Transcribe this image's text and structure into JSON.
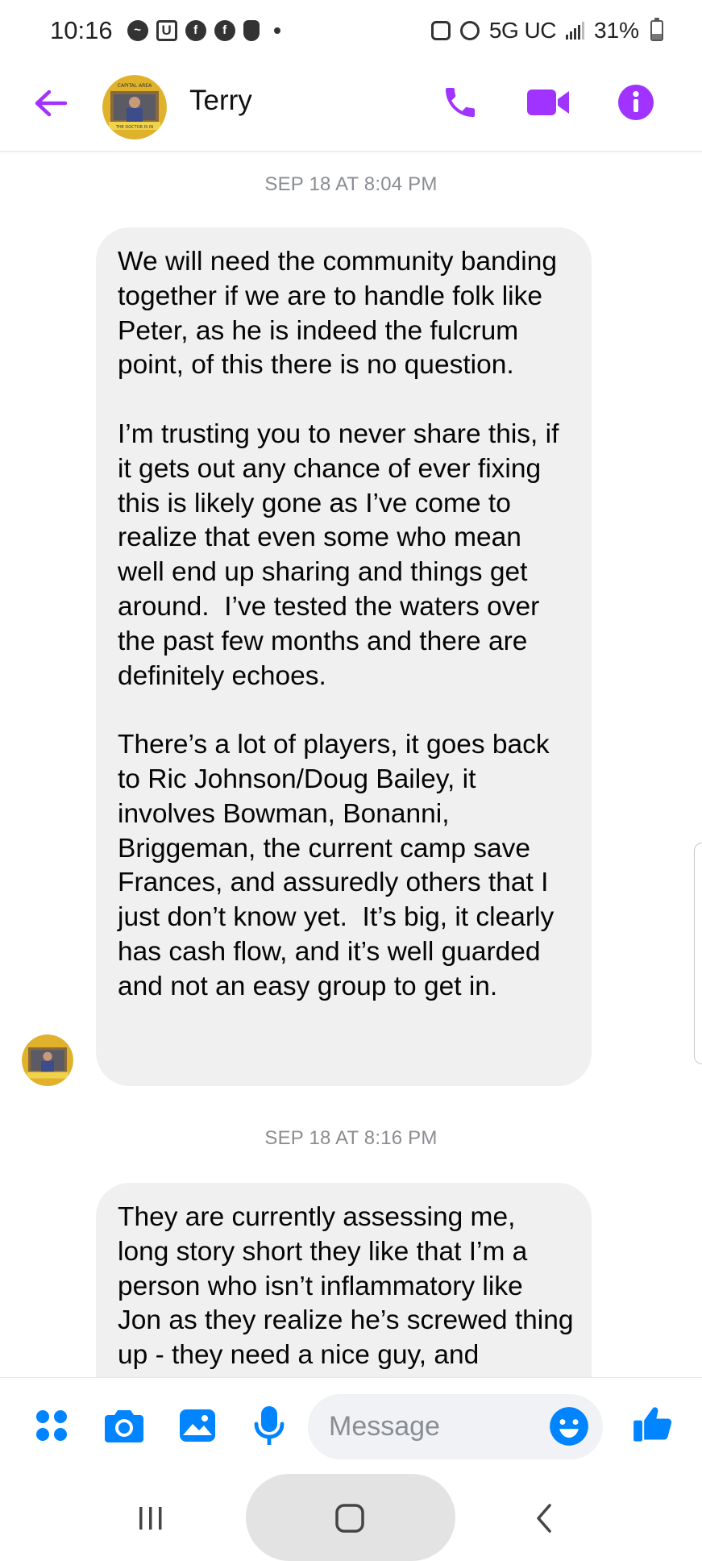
{
  "status_bar": {
    "time": "10:16",
    "network": "5G UC",
    "battery": "31%",
    "battery_level": 0.31
  },
  "header": {
    "contact_name": "Terry",
    "accent_color": "#a033ff",
    "avatar_caption_top": "CAPITAL AREA",
    "avatar_caption_bottom": "THE DOCTOR IS IN"
  },
  "conversation": {
    "messages": [
      {
        "timestamp": "SEP 18 AT 8:04 PM",
        "text": "We will need the community banding together if we are to handle folk like Peter, as he is indeed the fulcrum point, of this there is no question.\n\nI’m trusting you to never share this, if it gets out any chance of ever fixing this is likely gone as I’ve come to realize that even some who mean well end up sharing and things get around.  I’ve tested the waters over the past few months and there are definitely echoes.\n\nThere’s a lot of players, it goes back to Ric Johnson/Doug Bailey, it involves Bowman, Bonanni, Briggeman, the current camp save Frances, and assuredly others that I just don’t know yet.  It’s big, it clearly has cash flow, and it’s well guarded and not an easy group to get in."
      },
      {
        "timestamp": "SEP 18 AT 8:16 PM",
        "text": "They are currently assessing me, long story short they like that I’m a person who isn’t inflammatory like Jon as they realize he’s screwed thing up - they need a nice guy, and"
      }
    ]
  },
  "composer": {
    "placeholder": "Message",
    "value": "",
    "accent_color": "#0084ff"
  }
}
